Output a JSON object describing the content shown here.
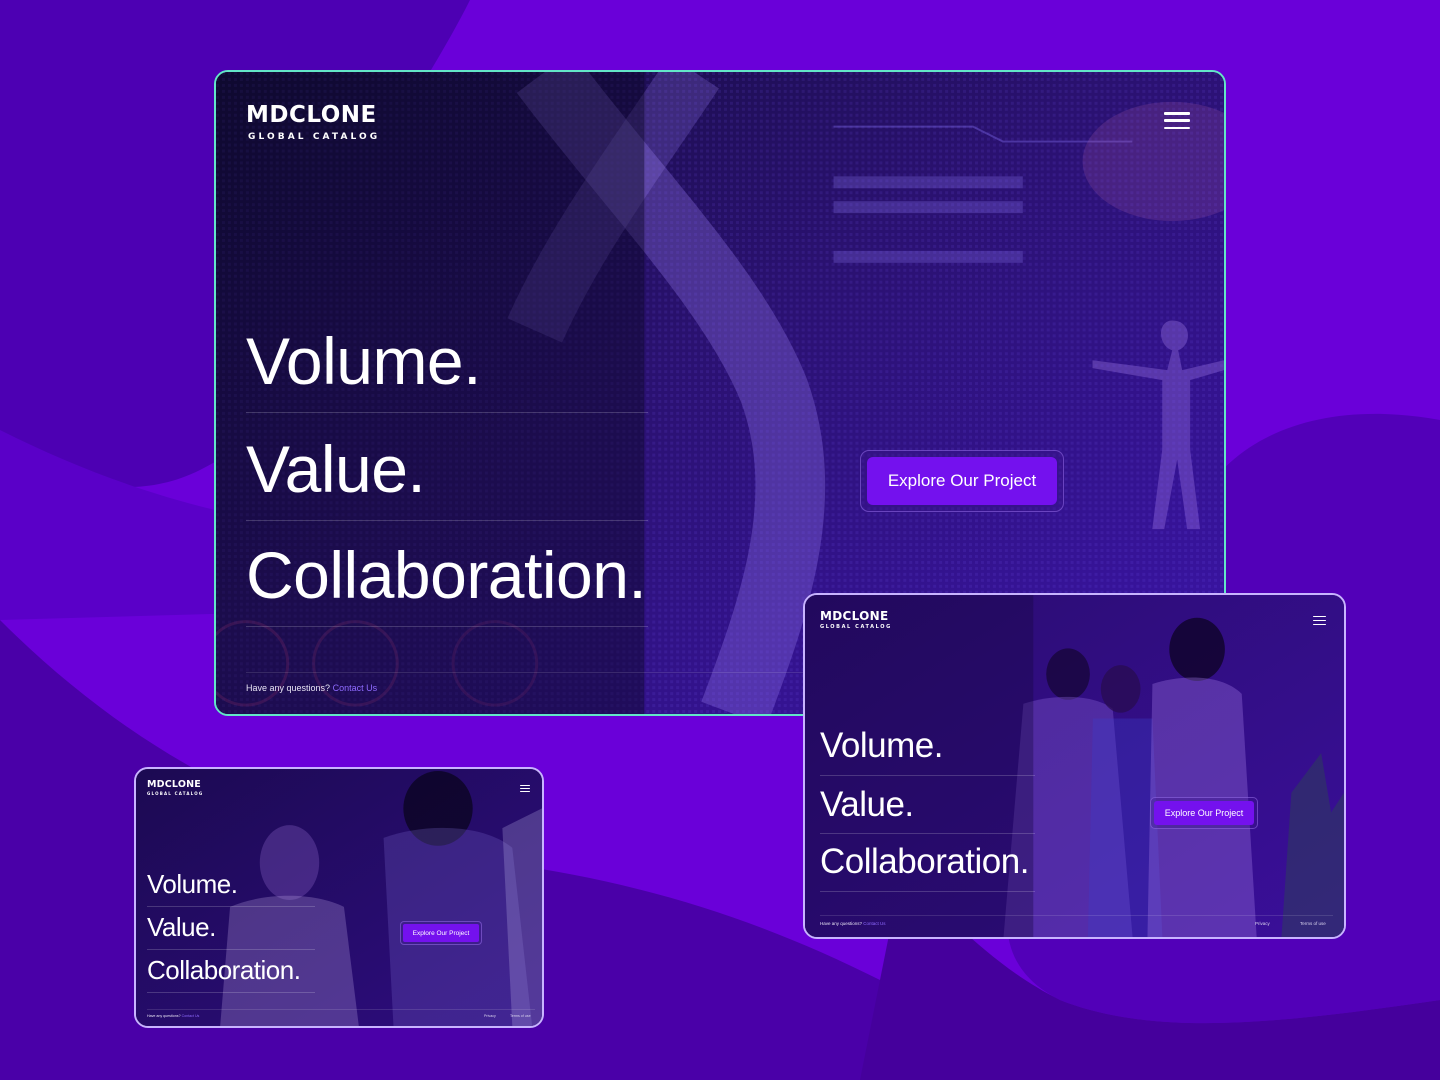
{
  "colors": {
    "background": "#6a00d9",
    "background_dark": "#4a00a8",
    "accent_button": "#7411ee",
    "link": "#8f6bff",
    "card_border_large": "#63e6c8",
    "card_border_small": "#c8b4ff"
  },
  "brand": {
    "name": "MDCLONE",
    "subtitle": "GLOBAL CATALOG"
  },
  "hero": {
    "lines": [
      "Volume.",
      "Value.",
      "Collaboration."
    ],
    "cta_label": "Explore Our Project"
  },
  "footer": {
    "question": "Have any questions?",
    "contact_label": "Contact Us",
    "privacy_label": "Privacy",
    "terms_label": "Terms of use"
  },
  "icons": {
    "menu": "hamburger-menu-icon"
  }
}
